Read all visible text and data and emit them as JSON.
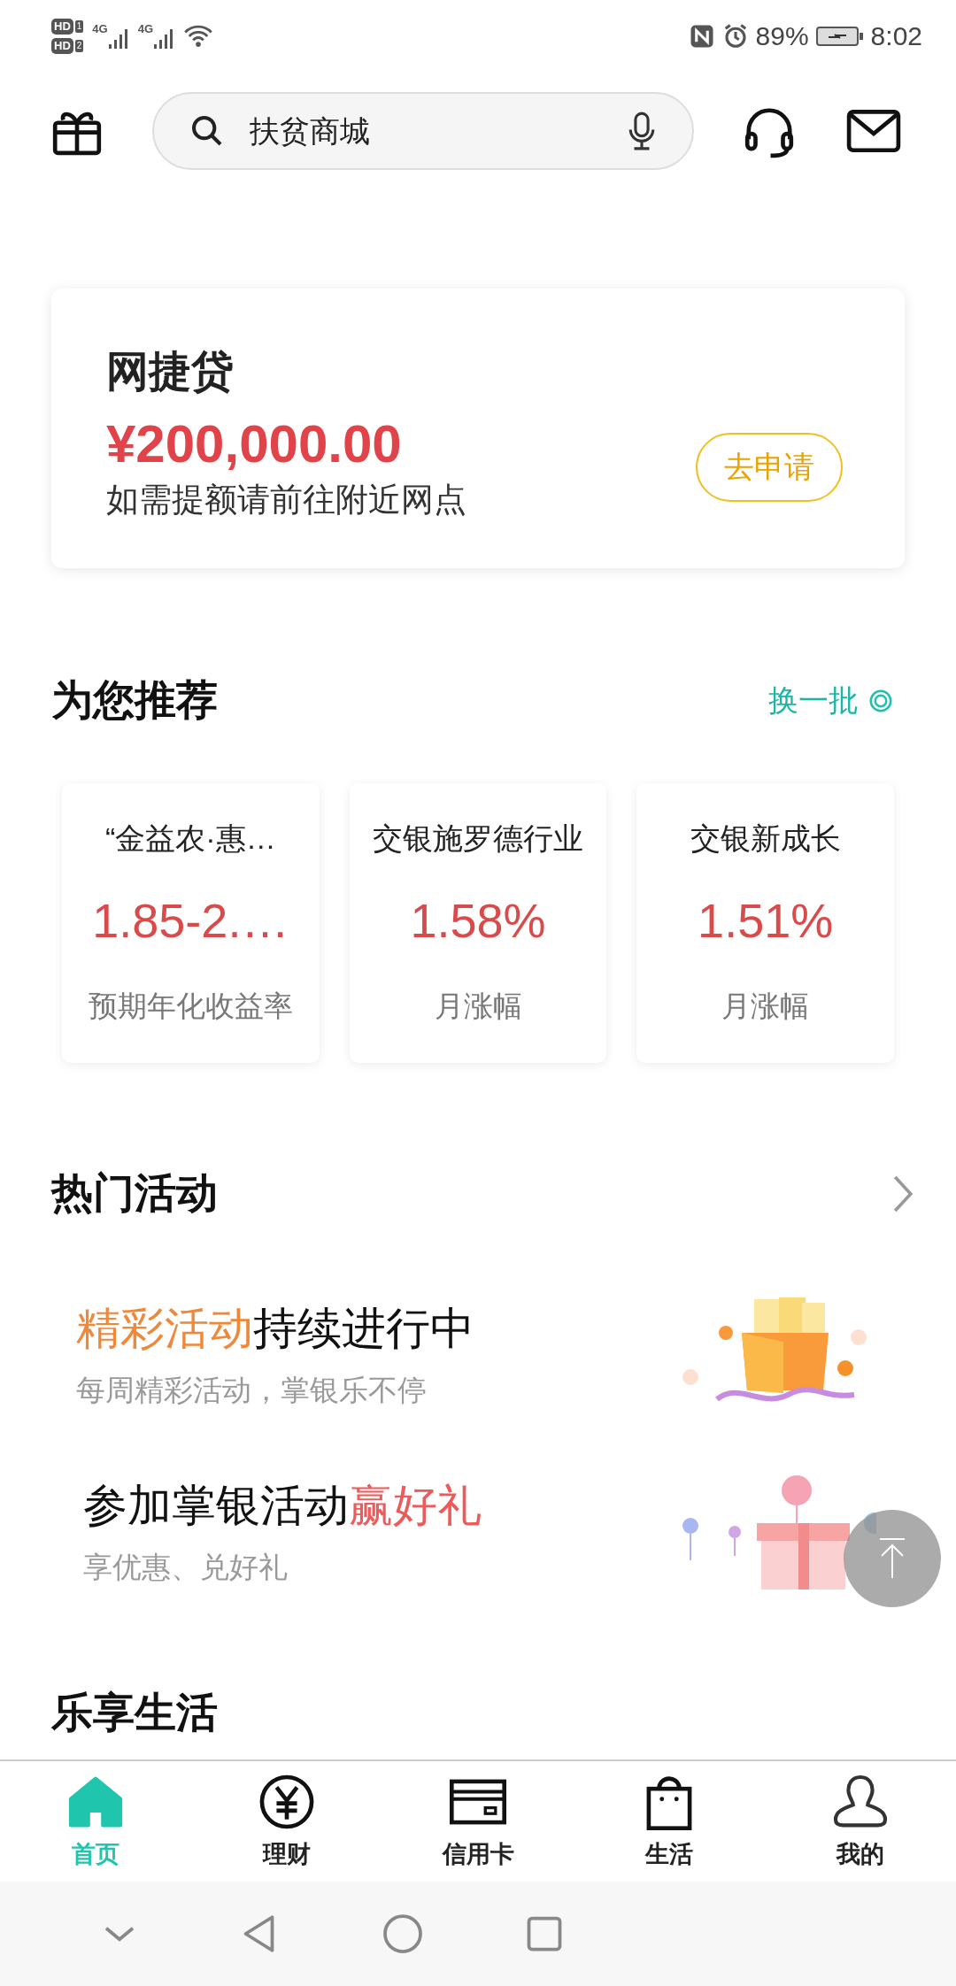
{
  "status_bar": {
    "sims": [
      {
        "badge": "HD",
        "slot": "1"
      },
      {
        "badge": "HD",
        "slot": "2"
      }
    ],
    "networks": [
      "4G",
      "4G"
    ],
    "battery_text": "89%",
    "time": "8:02"
  },
  "header": {
    "search": {
      "placeholder": "扶贫商城"
    }
  },
  "loan_card": {
    "title": "网捷贷",
    "amount": "¥200,000.00",
    "note": "如需提额请前往附近网点",
    "button": "去申请"
  },
  "recommend": {
    "title": "为您推荐",
    "refresh": "换一批",
    "products": [
      {
        "name": "“金益农·惠…",
        "value": "1.85-2.…",
        "label": "预期年化收益率"
      },
      {
        "name": "交银施罗德行业",
        "value": "1.58%",
        "label": "月涨幅"
      },
      {
        "name": "交银新成长",
        "value": "1.51%",
        "label": "月涨幅"
      }
    ]
  },
  "activities": {
    "title": "热门活动",
    "items": [
      {
        "title_parts": [
          {
            "text": "精彩活动",
            "kind": "orange"
          },
          {
            "text": "持续进行中",
            "kind": "plain"
          }
        ],
        "subtitle": "每周精彩活动，掌银乐不停",
        "kind": "picture"
      },
      {
        "title_parts": [
          {
            "text": "参加掌银活动",
            "kind": "plain"
          },
          {
            "text": "赢好礼",
            "kind": "red"
          }
        ],
        "subtitle": "享优惠、兑好礼",
        "kind": "picture"
      }
    ]
  },
  "next_section": {
    "title": "乐享生活"
  },
  "tabs": [
    {
      "label": "首页",
      "kind": "home",
      "selected": true
    },
    {
      "label": "理财",
      "kind": "yuan",
      "selected": false
    },
    {
      "label": "信用卡",
      "kind": "card",
      "selected": false
    },
    {
      "label": "生活",
      "kind": "bag",
      "selected": false
    },
    {
      "label": "我的",
      "kind": "person",
      "selected": false
    }
  ]
}
